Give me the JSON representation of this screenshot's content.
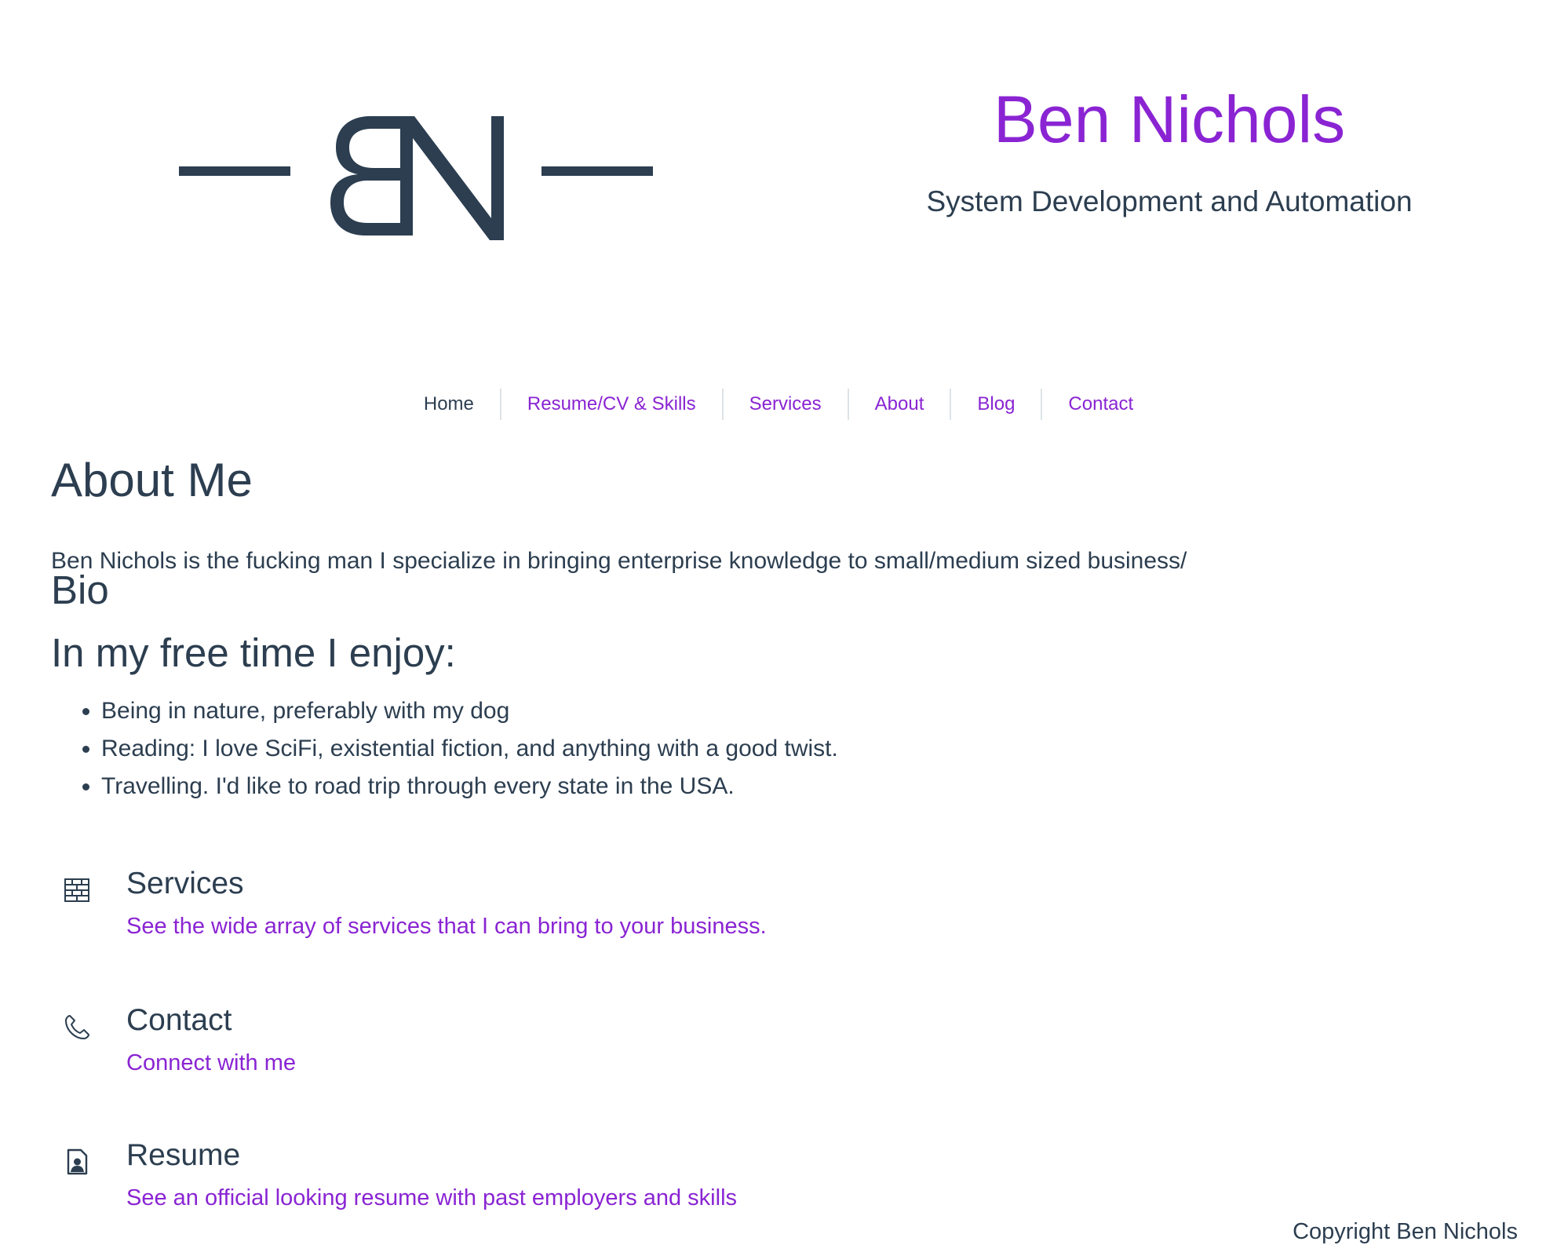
{
  "header": {
    "logo_text": "BN",
    "name": "Ben Nichols",
    "tagline": "System Development and Automation"
  },
  "nav": {
    "items": [
      {
        "label": "Home"
      },
      {
        "label": "Resume/CV & Skills"
      },
      {
        "label": "Services"
      },
      {
        "label": "About"
      },
      {
        "label": "Blog"
      },
      {
        "label": "Contact"
      }
    ]
  },
  "about": {
    "heading": "About Me",
    "intro": "Ben Nichols is the fucking man I specialize in bringing enterprise knowledge to small/medium sized business/",
    "bio_heading": "Bio",
    "free_time_heading": "In my free time I enjoy:",
    "interests": [
      "Being in nature, preferably with my dog",
      "Reading: I love SciFi, existential fiction, and anything with a good twist.",
      "Travelling. I'd like to road trip through every state in the USA."
    ]
  },
  "features": [
    {
      "icon": "brick-wall-icon",
      "title": "Services",
      "link": "See the wide array of services that I can bring to your business."
    },
    {
      "icon": "phone-icon",
      "title": "Contact",
      "link": "Connect with me"
    },
    {
      "icon": "resume-file-icon",
      "title": "Resume",
      "link": "See an official looking resume with past employers and skills"
    }
  ],
  "footer": {
    "copyright": "Copyright Ben Nichols"
  },
  "colors": {
    "accent": "#8a24d3",
    "text": "#2c3e50",
    "divider": "#dde3e8"
  }
}
